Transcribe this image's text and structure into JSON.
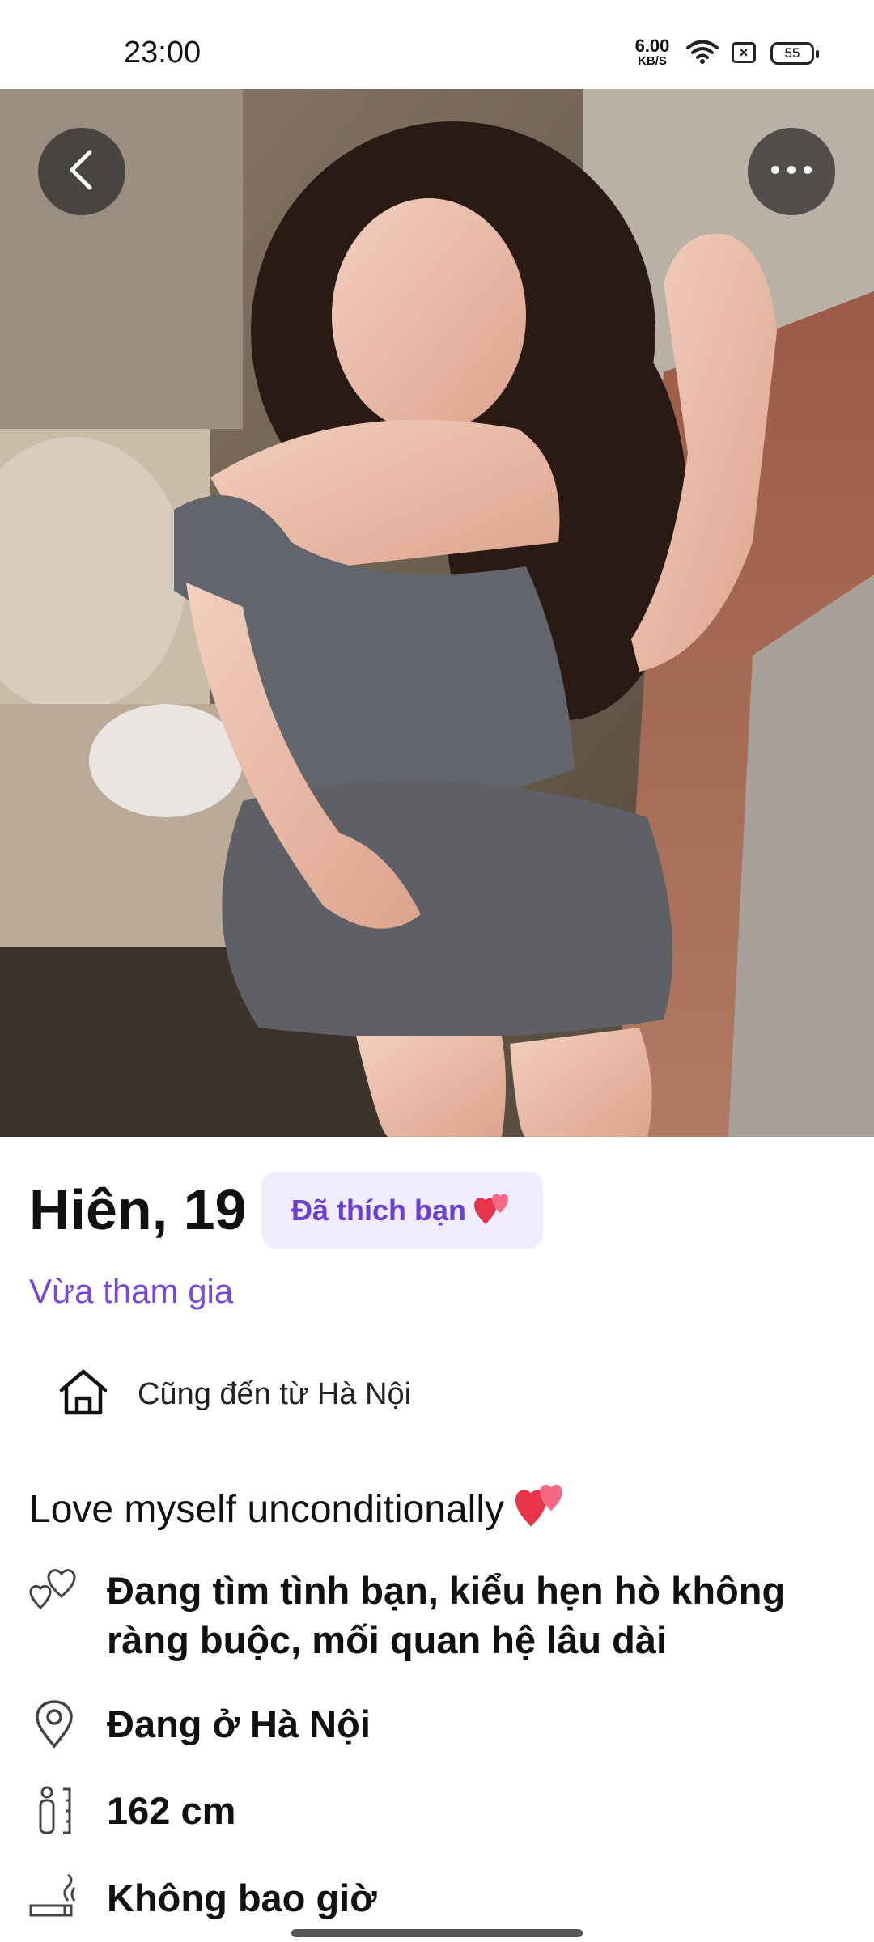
{
  "status_bar": {
    "time": "23:00",
    "net_speed": "6.00",
    "net_unit": "KB/S",
    "battery": "55"
  },
  "photo": {
    "description_icon": "profile-photo"
  },
  "profile": {
    "name_age": "Hiên, 19",
    "like_badge": "Đã thích bạn",
    "joined": "Vừa tham gia",
    "hometown": "Cũng đến từ Hà Nội",
    "bio": "Love myself unconditionally",
    "looking_for": "Đang tìm tình bạn, kiểu hẹn hò không ràng buộc, mối quan hệ lâu dài",
    "location": "Đang ở Hà Nội",
    "height": "162 cm",
    "smoking": "Không bao giờ"
  },
  "colors": {
    "accent": "#6b3fd0",
    "badge_bg": "#f1ecfd",
    "heart": "#e8344b"
  }
}
